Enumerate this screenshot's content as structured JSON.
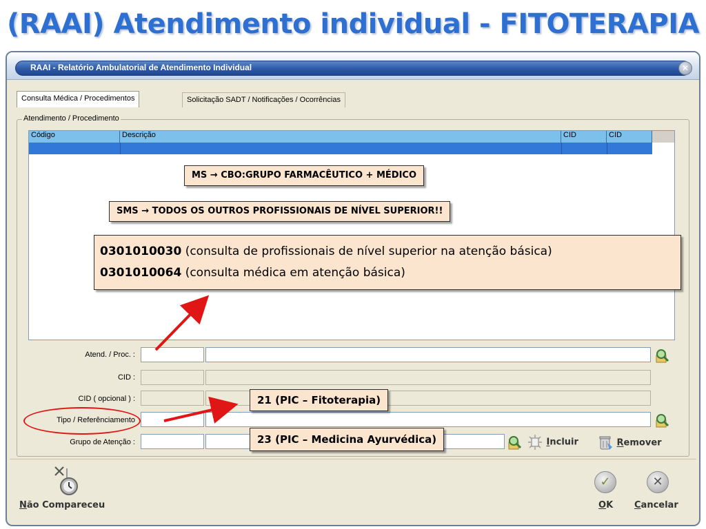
{
  "slide": {
    "title": "(RAAI) Atendimento individual - FITOTERAPIA"
  },
  "window": {
    "title": "RAAI - Relatório Ambulatorial de Atendimento Individual",
    "close_symbol": "✕",
    "tabs": [
      {
        "label": "Consulta Médica /  Procedimentos",
        "active": true
      },
      {
        "label": "Solicitação SADT / Notificações / Ocorrências",
        "active": false
      }
    ],
    "group_label": "Atendimento / Procedimento",
    "grid": {
      "columns": [
        "Código",
        "Descrição",
        "CID",
        "CID"
      ]
    },
    "form": {
      "atend_proc_label": "Atend. / Proc. :",
      "cid_label": "CID :",
      "cid_opcional_label": "CID ( opcional ) :",
      "tipo_label": "Tipo / Referênciamento",
      "grupo_label": "Grupo de Atenção :"
    },
    "actions": {
      "incluir_accel": "I",
      "incluir_rest": "ncluir",
      "remover_accel": "R",
      "remover_rest": "emover"
    },
    "footer": {
      "nao_compareceu_accel": "N",
      "nao_compareceu_rest": "ão Compareceu",
      "ok_accel": "O",
      "ok_rest": "K",
      "cancelar_accel": "C",
      "cancelar_rest": "ancelar",
      "ok_symbol": "✓",
      "cancel_symbol": "✕"
    }
  },
  "annotations": {
    "ms": "MS → CBO:GRUPO FARMACÊUTICO + MÉDICO",
    "sms": "SMS → TODOS OS OUTROS PROFISSIONAIS DE NÍVEL SUPERIOR!!",
    "code1": "0301010030",
    "code1_desc": " (consulta de profissionais de nível superior na atenção básica)",
    "code2": "0301010064",
    "code2_desc": " (consulta médica em atenção básica)",
    "pic21": "21 (PIC – Fitoterapia)",
    "pic23": "23 (PIC – Medicina Ayurvédica)"
  },
  "colors": {
    "title_blue": "#2e6fd2",
    "callout_bg": "#fbe5cf",
    "arrow_red": "#e01515",
    "grid_header": "#7ec0ec",
    "grid_selected": "#3178d8"
  }
}
